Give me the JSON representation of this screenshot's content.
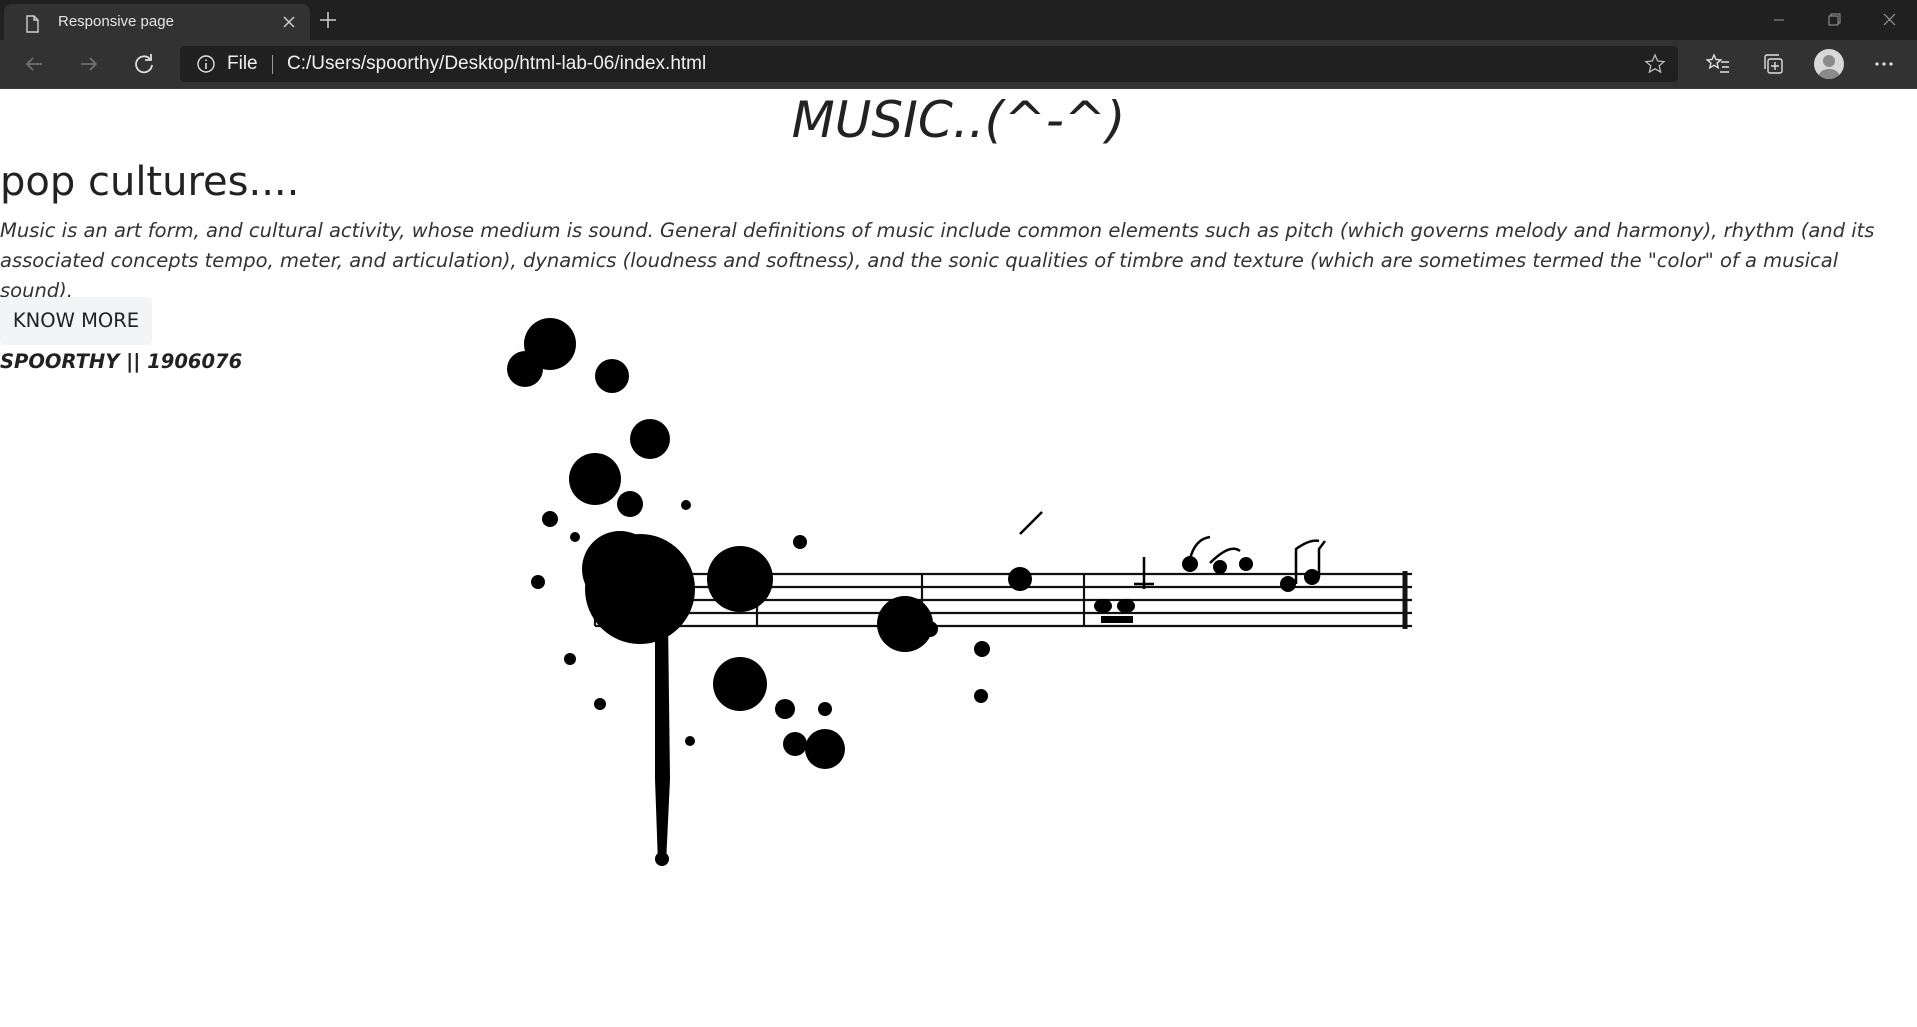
{
  "browser": {
    "tab_title": "Responsive page",
    "address_scheme_label": "File",
    "address_url": "C:/Users/spoorthy/Desktop/html-lab-06/index.html",
    "icons": [
      "page-icon",
      "close-icon",
      "plus-icon",
      "minimize-icon",
      "restore-icon",
      "window-close-icon",
      "back-icon",
      "forward-icon",
      "refresh-icon",
      "info-icon",
      "star-icon",
      "favorites-icon",
      "collections-icon",
      "profile-icon",
      "more-icon"
    ]
  },
  "page": {
    "heading": "MUSIC..(^-^)",
    "subheading": "pop cultures....",
    "paragraph": "Music is an art form, and cultural activity, whose medium is sound. General definitions of music include common elements such as pitch (which governs melody and harmony), rhythm (and its associated concepts tempo, meter, and articulation), dynamics (loudness and softness), and the sonic qualities of timbre and texture (which are sometimes termed the \"color\" of a musical sound).",
    "button_label": "KNOW MORE",
    "signature": "SPOORTHY || 1906076",
    "image_description_icon": "music-staff-ink-splatter"
  }
}
